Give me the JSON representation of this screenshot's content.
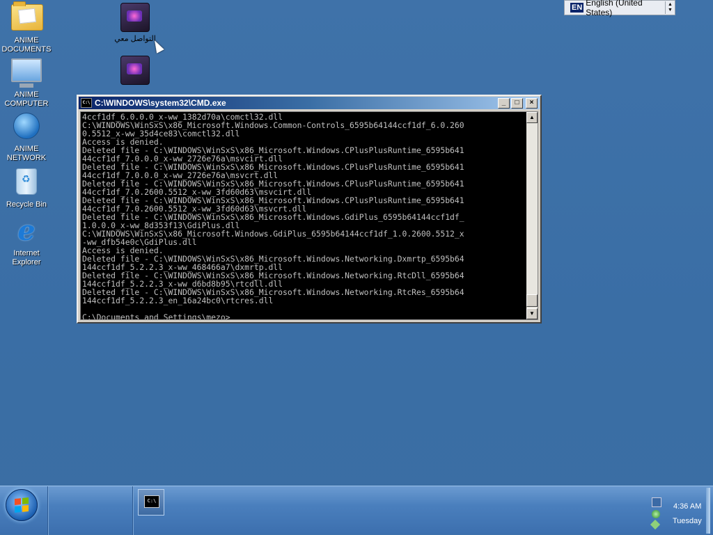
{
  "desktop": {
    "icons": [
      {
        "label": "ANIME\nDOCUMENTS",
        "icon": "folder-icon"
      },
      {
        "label": "ANIME\nCOMPUTER",
        "icon": "computer-icon"
      },
      {
        "label": "ANIME\nNETWORK",
        "icon": "network-icon"
      },
      {
        "label": "Recycle Bin",
        "icon": "recycle-bin-icon"
      },
      {
        "label": "Internet\nExplorer",
        "icon": "internet-explorer-icon"
      },
      {
        "label": "التواصل معي",
        "icon": "dark-folder-icon"
      },
      {
        "label": "",
        "icon": "dark-folder-icon"
      }
    ]
  },
  "language_bar": {
    "code": "EN",
    "label": "English (United States)"
  },
  "cmd_window": {
    "title": "C:\\WINDOWS\\system32\\CMD.exe",
    "icon_text": "C:\\",
    "buttons": {
      "minimize": "_",
      "maximize": "□",
      "close": "×"
    },
    "output_lines": [
      "4ccf1df_6.0.0.0_x-ww_1382d70a\\comctl32.dll",
      "C:\\WINDOWS\\WinSxS\\x86_Microsoft.Windows.Common-Controls_6595b64144ccf1df_6.0.260",
      "0.5512_x-ww_35d4ce83\\comctl32.dll",
      "Access is denied.",
      "Deleted file - C:\\WINDOWS\\WinSxS\\x86_Microsoft.Windows.CPlusPlusRuntime_6595b641",
      "44ccf1df_7.0.0.0_x-ww_2726e76a\\msvcirt.dll",
      "Deleted file - C:\\WINDOWS\\WinSxS\\x86_Microsoft.Windows.CPlusPlusRuntime_6595b641",
      "44ccf1df_7.0.0.0_x-ww_2726e76a\\msvcrt.dll",
      "Deleted file - C:\\WINDOWS\\WinSxS\\x86_Microsoft.Windows.CPlusPlusRuntime_6595b641",
      "44ccf1df_7.0.2600.5512_x-ww_3fd60d63\\msvcirt.dll",
      "Deleted file - C:\\WINDOWS\\WinSxS\\x86_Microsoft.Windows.CPlusPlusRuntime_6595b641",
      "44ccf1df_7.0.2600.5512_x-ww_3fd60d63\\msvcrt.dll",
      "Deleted file - C:\\WINDOWS\\WinSxS\\x86_Microsoft.Windows.GdiPlus_6595b64144ccf1df_",
      "1.0.0.0_x-ww_8d353f13\\GdiPlus.dll",
      "C:\\WINDOWS\\WinSxS\\x86_Microsoft.Windows.GdiPlus_6595b64144ccf1df_1.0.2600.5512_x",
      "-ww_dfb54e0c\\GdiPlus.dll",
      "Access is denied.",
      "Deleted file - C:\\WINDOWS\\WinSxS\\x86_Microsoft.Windows.Networking.Dxmrtp_6595b64",
      "144ccf1df_5.2.2.3_x-ww_468466a7\\dxmrtp.dll",
      "Deleted file - C:\\WINDOWS\\WinSxS\\x86_Microsoft.Windows.Networking.RtcDll_6595b64",
      "144ccf1df_5.2.2.3_x-ww_d6bd8b95\\rtcdll.dll",
      "Deleted file - C:\\WINDOWS\\WinSxS\\x86_Microsoft.Windows.Networking.RtcRes_6595b64",
      "144ccf1df_5.2.2.3_en_16a24bc0\\rtcres.dll",
      "",
      "C:\\Documents and Settings\\mezo>"
    ]
  },
  "taskbar": {
    "task_button_icon_text": "C:\\",
    "clock": "4:36 AM",
    "day": "Tuesday"
  }
}
